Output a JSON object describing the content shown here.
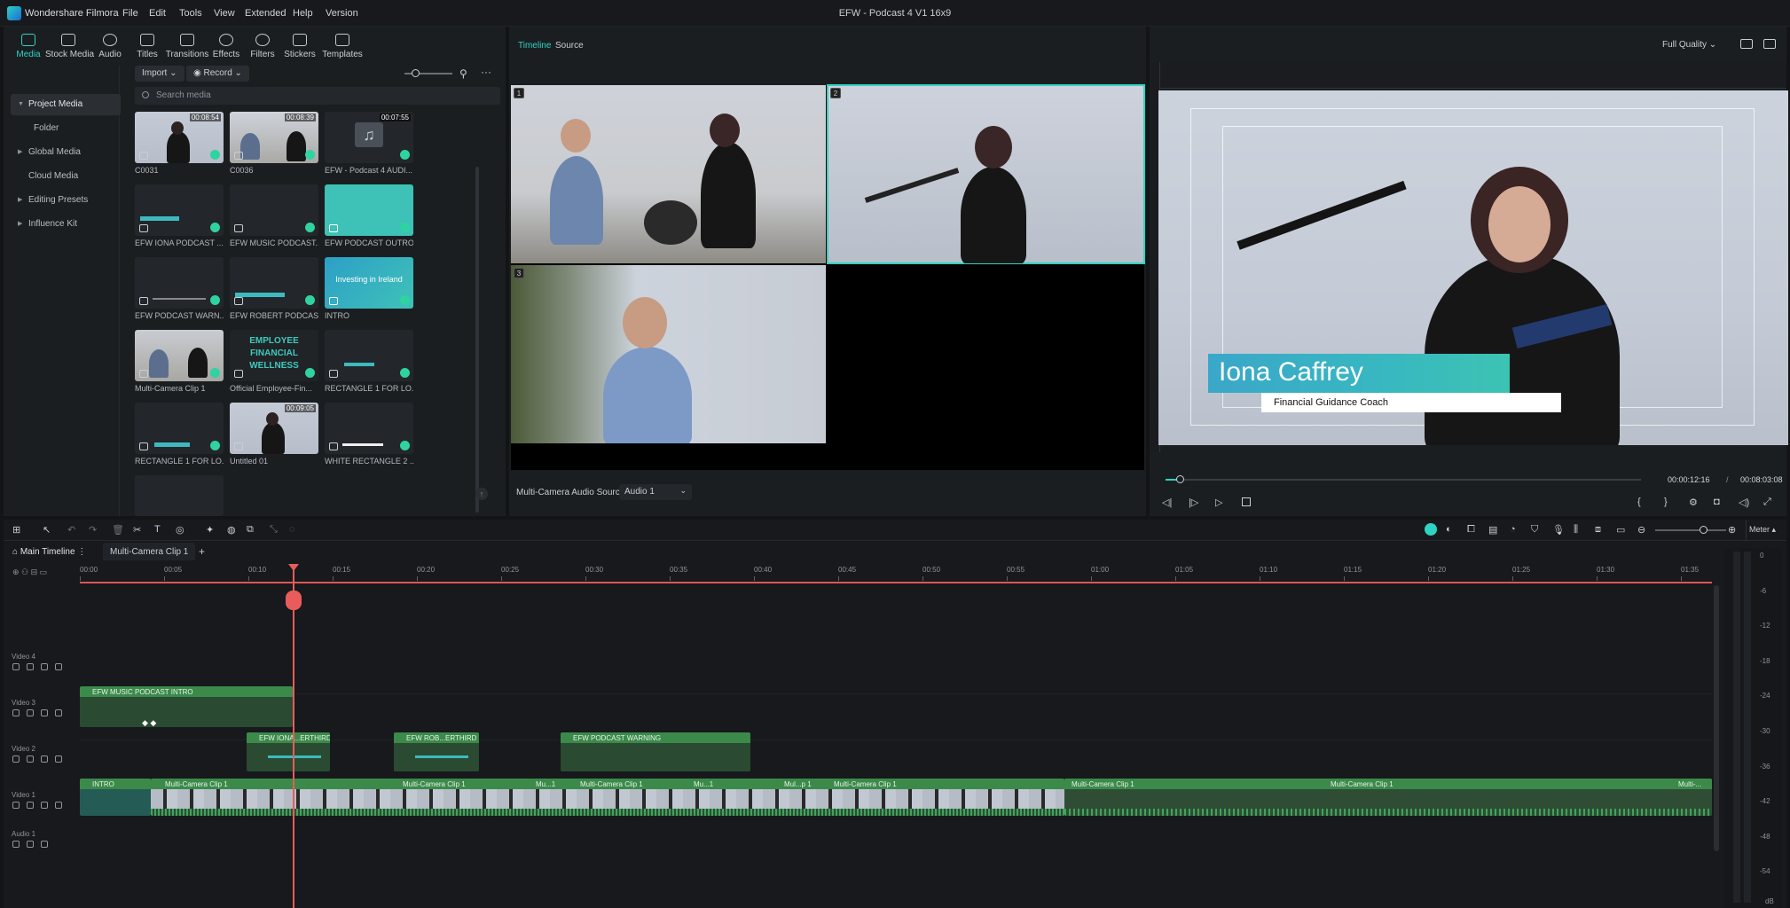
{
  "app": {
    "name": "Wondershare Filmora",
    "menu": [
      "File",
      "Edit",
      "Tools",
      "View",
      "Extended",
      "Help",
      "Version"
    ],
    "document_title": "EFW - Podcast 4 V1 16x9"
  },
  "toolbar": {
    "items": [
      {
        "label": "Media",
        "icon": "media-icon",
        "active": true
      },
      {
        "label": "Stock Media",
        "icon": "stock-media-icon"
      },
      {
        "label": "Audio",
        "icon": "audio-icon"
      },
      {
        "label": "Titles",
        "icon": "titles-icon"
      },
      {
        "label": "Transitions",
        "icon": "transitions-icon"
      },
      {
        "label": "Effects",
        "icon": "effects-icon"
      },
      {
        "label": "Filters",
        "icon": "filters-icon"
      },
      {
        "label": "Stickers",
        "icon": "stickers-icon"
      },
      {
        "label": "Templates",
        "icon": "templates-icon"
      }
    ]
  },
  "sidebar": {
    "items": [
      {
        "label": "Project Media",
        "expanded": true
      },
      {
        "label": "Folder"
      },
      {
        "label": "Global Media"
      },
      {
        "label": "Cloud Media"
      },
      {
        "label": "Editing Presets"
      },
      {
        "label": "Influence Kit"
      }
    ]
  },
  "media": {
    "import_label": "Import",
    "record_label": "Record",
    "search_placeholder": "Search media",
    "items": [
      {
        "name": "C0031",
        "duration": "00:08:54"
      },
      {
        "name": "C0036",
        "duration": "00:08:39"
      },
      {
        "name": "EFW - Podcast 4 AUDI...",
        "duration": "00:07:55"
      },
      {
        "name": "EFW IONA PODCAST ..."
      },
      {
        "name": "EFW MUSIC PODCAST..."
      },
      {
        "name": "EFW PODCAST OUTRO"
      },
      {
        "name": "EFW PODCAST WARN..."
      },
      {
        "name": "EFW ROBERT PODCAS..."
      },
      {
        "name": "INTRO",
        "thumb_text": "Investing in Ireland"
      },
      {
        "name": "Multi-Camera Clip 1"
      },
      {
        "name": "Official Employee-Fin...",
        "thumb_text": "EMPLOYEE FINANCIAL WELLNESS"
      },
      {
        "name": "RECTANGLE 1 FOR LO..."
      },
      {
        "name": "RECTANGLE 1 FOR LO..."
      },
      {
        "name": "Untitled 01",
        "duration": "00:09:05"
      },
      {
        "name": "WHITE RECTANGLE 2 ..."
      }
    ]
  },
  "multicam": {
    "tabs": [
      "Timeline",
      "Source"
    ],
    "active_tab": "Timeline",
    "audio_source_label": "Multi-Camera Audio Source",
    "audio_source_value": "Audio 1",
    "cameras": [
      "1",
      "2",
      "3"
    ]
  },
  "preview": {
    "quality": "Full Quality",
    "lower_third_name": "Iona Caffrey",
    "lower_third_title": "Financial Guidance Coach",
    "current_time": "00:00:12:16",
    "separator": "/",
    "total_time": "00:08:03:08",
    "progress": 0.03
  },
  "timeline": {
    "tabs": [
      "Main Timeline",
      "Multi-Camera Clip 1"
    ],
    "meter_label": "Meter",
    "ruler": [
      "00:00",
      "00:05",
      "00:10",
      "00:15",
      "00:20",
      "00:25",
      "00:30",
      "00:35",
      "00:40",
      "00:45",
      "00:50",
      "00:55",
      "01:00",
      "01:05",
      "01:10",
      "01:15",
      "01:20",
      "01:25",
      "01:30",
      "01:35"
    ],
    "tracks": [
      "Video 4",
      "Video 3",
      "Video 2",
      "Video 1",
      "Audio 1"
    ],
    "clips": {
      "v3": "EFW MUSIC PODCAST INTRO",
      "v2a": "EFW IONA...ERTHIRD",
      "v2b": "EFW ROB...ERTHIRD",
      "v2c": "EFW PODCAST WARNING",
      "v1_intro": "INTRO",
      "v1_mc": "Multi-Camera Clip 1",
      "v1_short1": "Mu...1",
      "v1_short2": "Mu...1",
      "v1_short3": "Mul...p 1",
      "v1_tail": "Multi-..."
    },
    "meter_scale": [
      "0",
      "-6",
      "-12",
      "-18",
      "-24",
      "-30",
      "-36",
      "-42",
      "-48",
      "-54"
    ],
    "meter_unit": "dB"
  },
  "colors": {
    "accent": "#2fd3c3",
    "playhead": "#e85c5c",
    "clip_green": "#3b8a4a",
    "clip_dark": "#2a4a31"
  }
}
